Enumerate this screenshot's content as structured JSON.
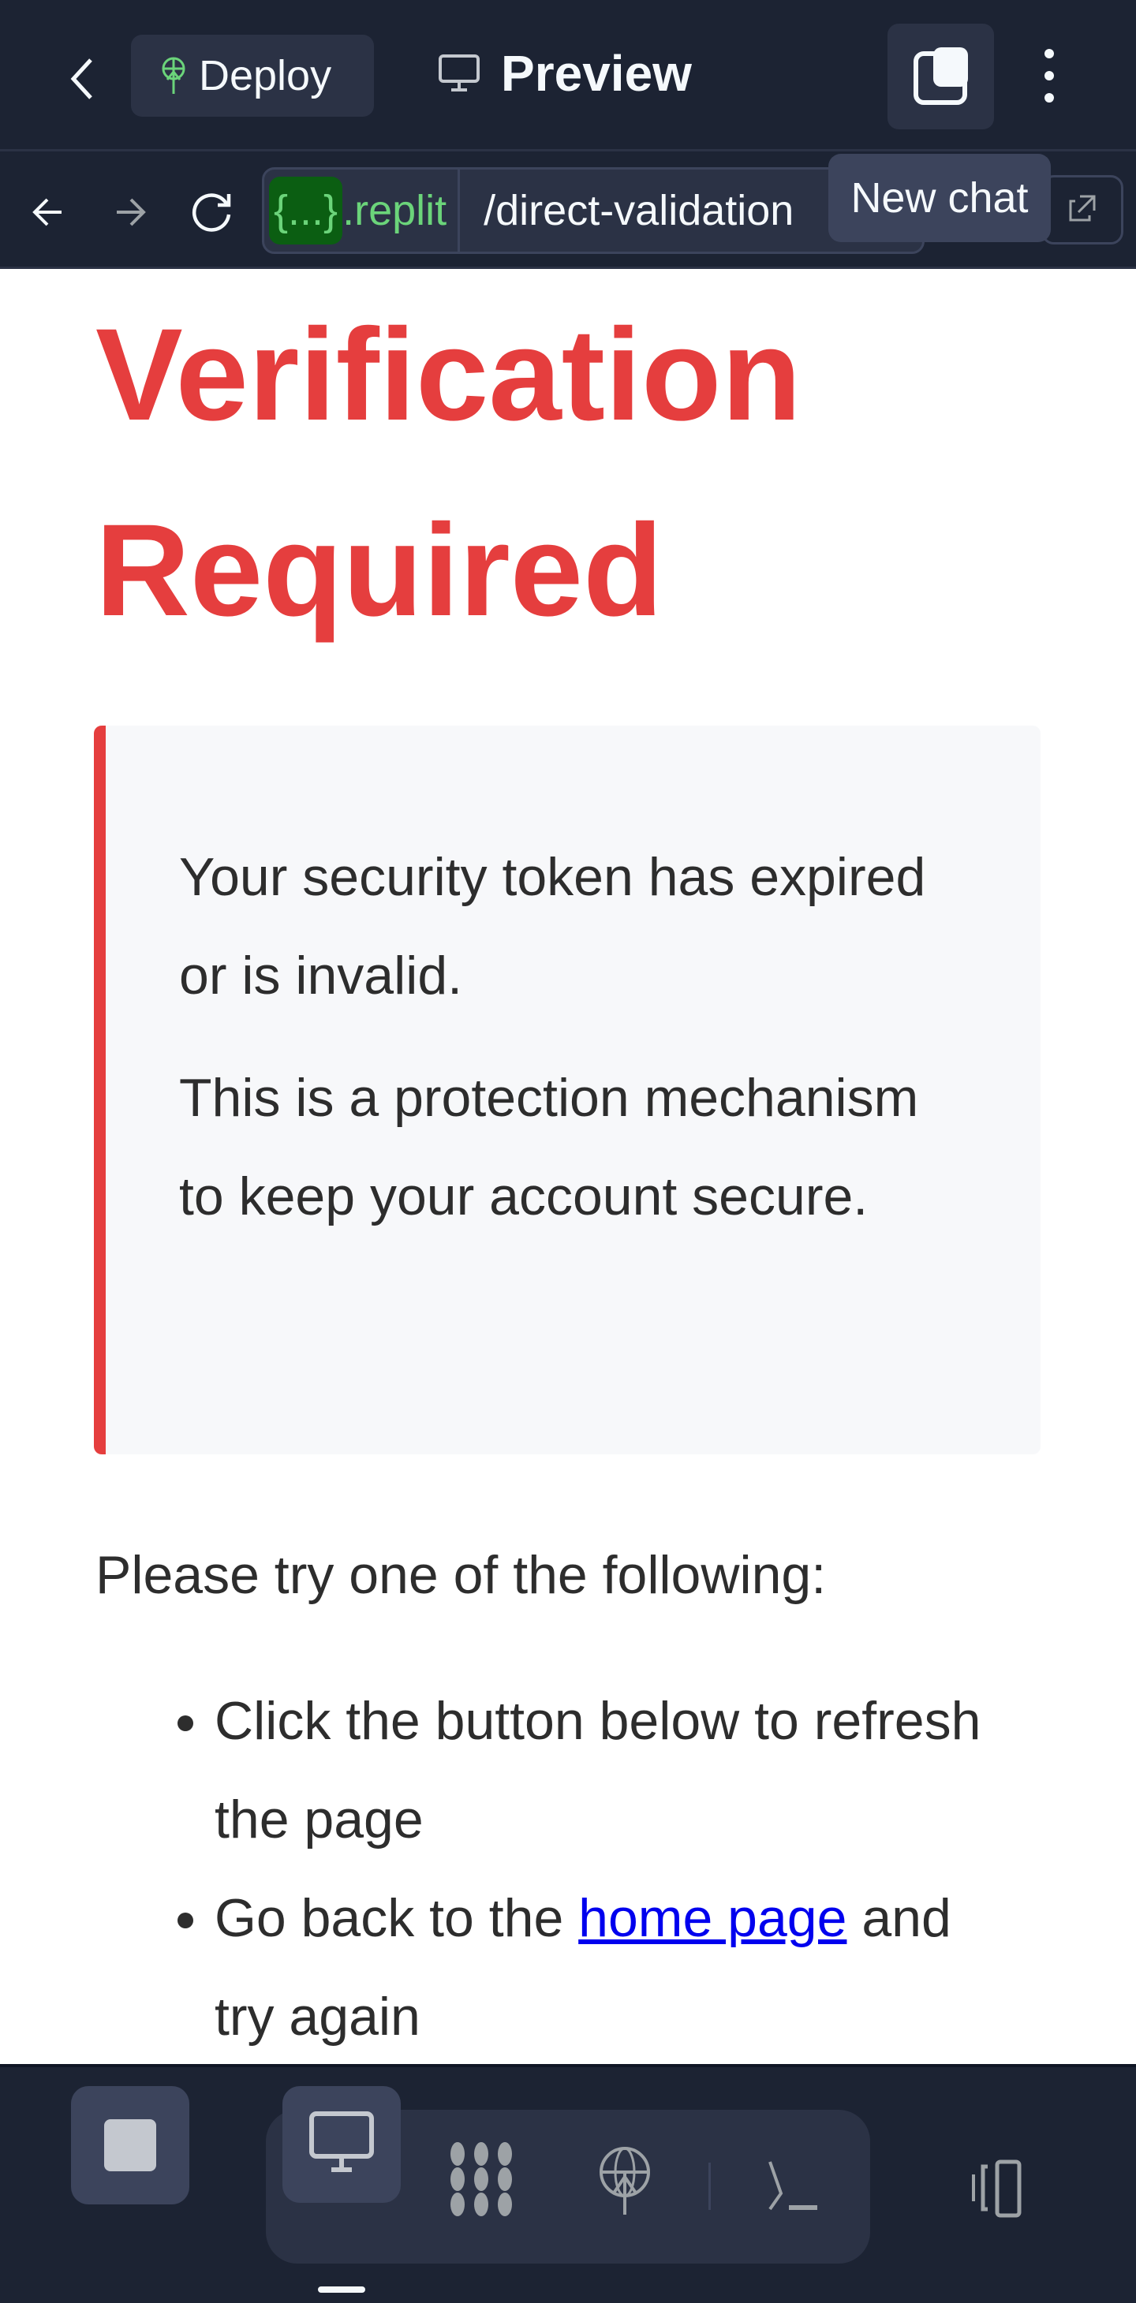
{
  "topbar": {
    "deploy_label": "Deploy",
    "preview_label": "Preview",
    "new_chat_tooltip": "New chat"
  },
  "urlbar": {
    "host_badge": "{...}",
    "host_suffix": ".replit",
    "path": "/direct-validation"
  },
  "page": {
    "title": "Verification Required",
    "notice": [
      "Your security token has expired or is invalid.",
      "This is a protection mechanism to keep your account secure."
    ],
    "intro": "Please try one of the following:",
    "list": {
      "item1": "Click the button below to refresh the page",
      "item2_before": "Go back to the ",
      "item2_link": "home page",
      "item2_after": " and try again"
    }
  },
  "colors": {
    "accent": "#e53e3e",
    "bar_bg": "#1c2333",
    "replit_green": "#6bd47a"
  }
}
